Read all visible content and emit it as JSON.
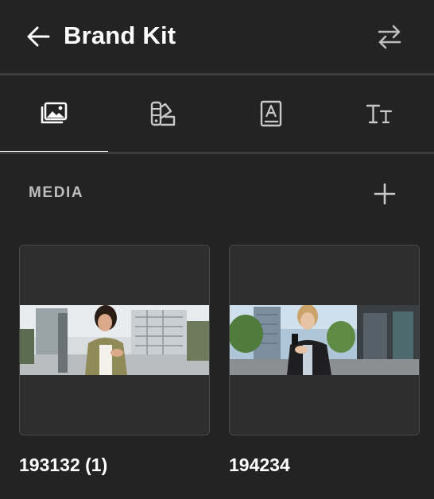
{
  "header": {
    "title": "Brand Kit",
    "back_icon": "arrow-left-icon",
    "swap_icon": "swap-arrows-icon"
  },
  "tabs": [
    {
      "icon": "media-icon",
      "active": true
    },
    {
      "icon": "palette-icon",
      "active": false
    },
    {
      "icon": "font-book-icon",
      "active": false
    },
    {
      "icon": "text-size-icon",
      "active": false
    }
  ],
  "section": {
    "label": "MEDIA",
    "add_icon": "plus-icon"
  },
  "media": [
    {
      "name": "193132 (1)"
    },
    {
      "name": "194234"
    }
  ],
  "colors": {
    "background": "#232323",
    "divider": "#3d3d3d",
    "card": "#2e2e2e",
    "text": "#ffffff",
    "muted": "#bdbdbd"
  }
}
